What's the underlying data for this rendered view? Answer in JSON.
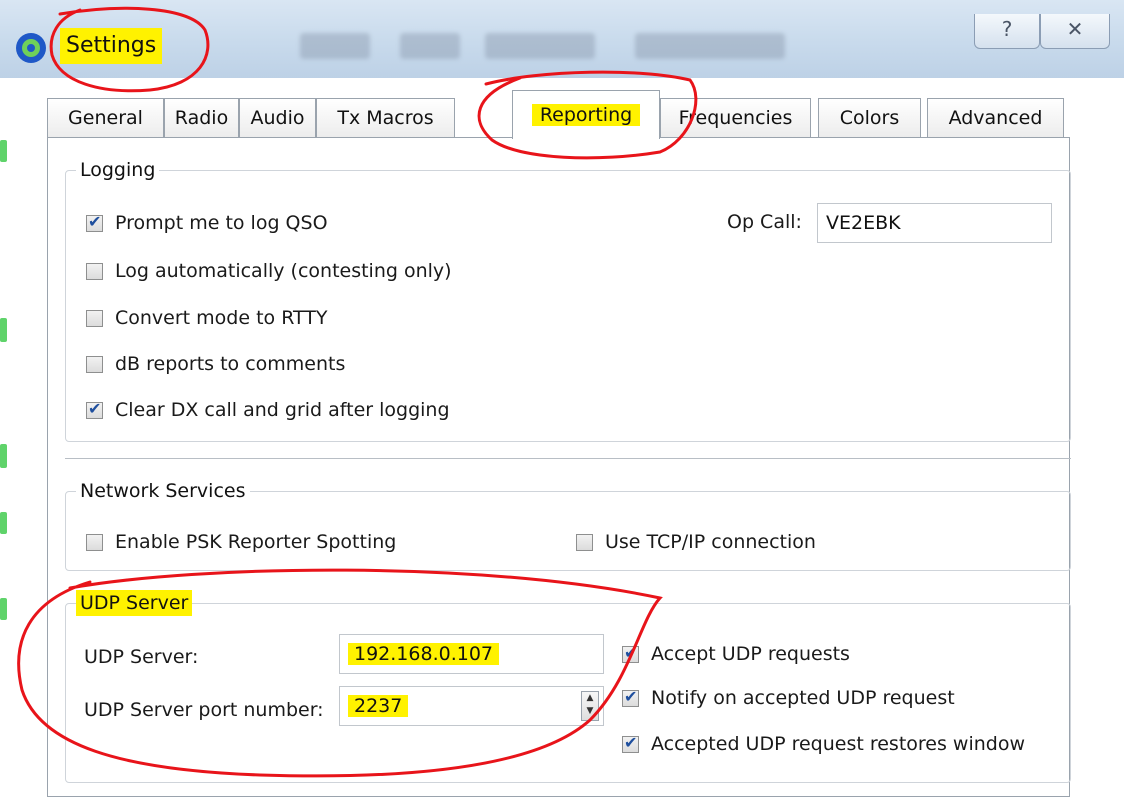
{
  "window": {
    "title": "Settings",
    "help_glyph": "?",
    "close_glyph": "✕"
  },
  "tabs": [
    {
      "label": "General"
    },
    {
      "label": "Radio"
    },
    {
      "label": "Audio"
    },
    {
      "label": "Tx Macros"
    },
    {
      "label": "Reporting",
      "active": true
    },
    {
      "label": "Frequencies"
    },
    {
      "label": "Colors"
    },
    {
      "label": "Advanced"
    }
  ],
  "logging": {
    "title": "Logging",
    "prompt_log": {
      "label": "Prompt me to log QSO",
      "checked": true
    },
    "log_auto": {
      "label": "Log automatically (contesting only)",
      "checked": false
    },
    "convert_rtty": {
      "label": "Convert mode to RTTY",
      "checked": false
    },
    "db_reports": {
      "label": "dB reports to comments",
      "checked": false
    },
    "clear_dx": {
      "label": "Clear DX call and grid after logging",
      "checked": true
    },
    "op_call_label": "Op Call:",
    "op_call_value": "VE2EBK"
  },
  "network": {
    "title": "Network Services",
    "psk_reporter": {
      "label": "Enable PSK Reporter Spotting",
      "checked": false
    },
    "tcp_ip": {
      "label": "Use TCP/IP connection",
      "checked": false
    }
  },
  "udp": {
    "title": "UDP Server",
    "server_label": "UDP Server:",
    "server_value": "192.168.0.107",
    "port_label": "UDP Server port number:",
    "port_value": "2237",
    "accept_requests": {
      "label": "Accept UDP requests",
      "checked": true
    },
    "notify_accepted": {
      "label": "Notify on accepted UDP request",
      "checked": true
    },
    "restore_window": {
      "label": "Accepted UDP request restores window",
      "checked": true
    }
  },
  "colors": {
    "highlight": "#fff200",
    "annotation": "#e8141a",
    "titlebar": "#c8daec"
  }
}
